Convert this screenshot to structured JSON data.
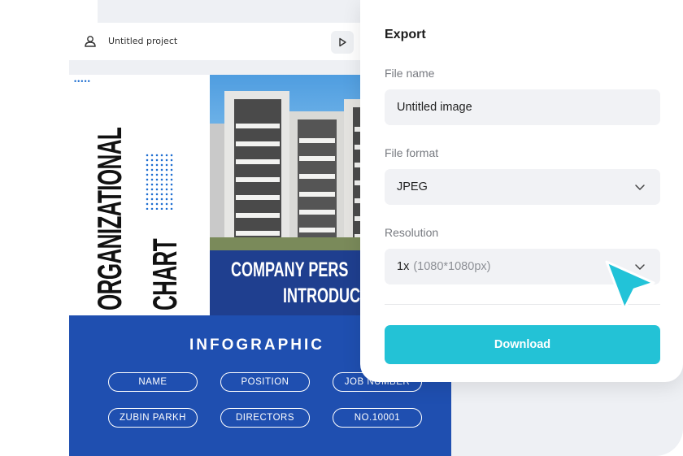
{
  "editor": {
    "project_title": "Untitled project",
    "icons": {
      "project": "cloud-user-icon",
      "play": "play-icon"
    }
  },
  "design": {
    "vertical_title_line1": "ORGANIZATIONAL",
    "vertical_title_line2": "CHART",
    "dots_top": "•••••",
    "band_line1": "COMPANY PERS",
    "band_line2": "INTRODUCT",
    "infographic_title": "INFOGRAPHIC",
    "pills": [
      "NAME",
      "POSITION",
      "JOB NUMBER",
      "ZUBIN PARKH",
      "DIRECTORS",
      "NO.10001"
    ]
  },
  "export": {
    "title": "Export",
    "file_name_label": "File name",
    "file_name_value": "Untitled image",
    "file_format_label": "File format",
    "file_format_value": "JPEG",
    "resolution_label": "Resolution",
    "resolution_value": "1x",
    "resolution_detail": "(1080*1080px)",
    "download_label": "Download",
    "chevron_icon": "chevron-down-icon"
  },
  "colors": {
    "accent": "#23c2d6",
    "design_blue": "#1f4fb0",
    "band_navy": "#1f3f8f",
    "cursor": "#22c3d8"
  }
}
